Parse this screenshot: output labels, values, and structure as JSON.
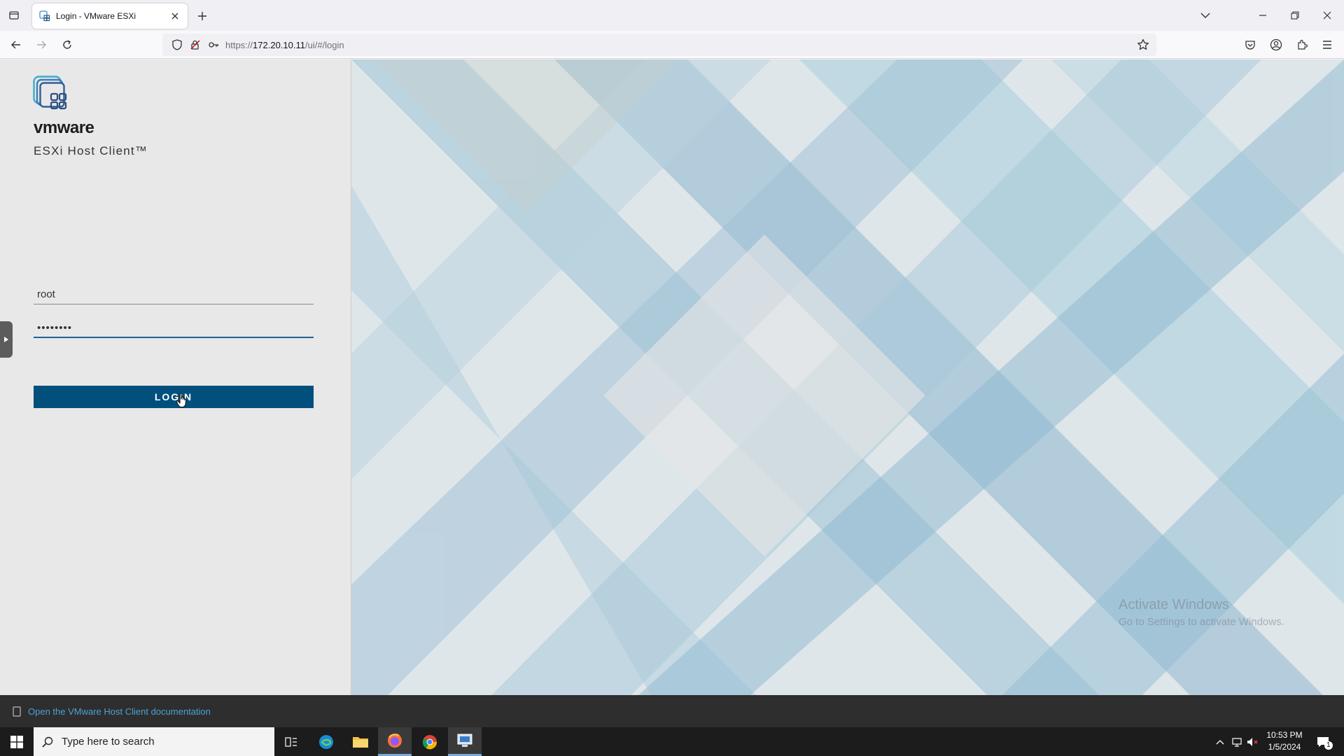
{
  "browser": {
    "tab_title": "Login - VMware ESXi",
    "url_gray_prefix": "https://",
    "url_host": "172.20.10.11",
    "url_path": "/ui/#/login"
  },
  "login": {
    "brand": "vmware",
    "product": "ESXi Host Client™",
    "username_value": "root",
    "password_value": "••••••••",
    "login_label": "LOGIN"
  },
  "footer": {
    "doc_link": "Open the VMware Host Client documentation"
  },
  "watermark": {
    "line1": "Activate Windows",
    "line2": "Go to Settings to activate Windows."
  },
  "taskbar": {
    "search_placeholder": "Type here to search",
    "time": "10:53 PM",
    "date": "1/5/2024",
    "notification_count": "1"
  },
  "colors": {
    "login_button": "#004f7d",
    "password_underline": "#1f6296",
    "footer_link": "#4ba2d8"
  }
}
